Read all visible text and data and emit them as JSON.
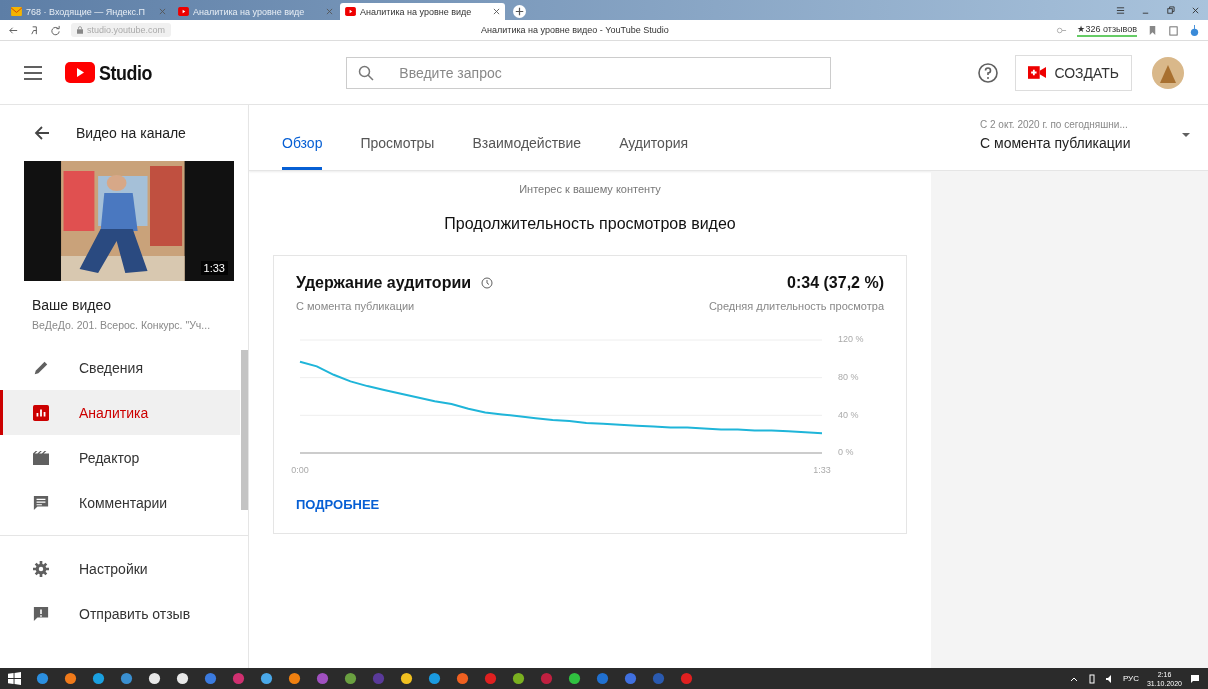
{
  "browser": {
    "tabs": [
      {
        "title": "768 · Входящие — Яндекс.П",
        "selected": false,
        "kind": "mail"
      },
      {
        "title": "Аналитика на уровне виде",
        "selected": false,
        "kind": "youtube"
      },
      {
        "title": "Аналитика на уровне виде",
        "selected": true,
        "kind": "youtube"
      }
    ],
    "url": "studio.youtube.com",
    "page_title": "Аналитика на уровне видео - YouTube Studio",
    "reviews": "★326 отзывов"
  },
  "header": {
    "logo": "Studio",
    "search_placeholder": "Введите запрос",
    "create_button": "СОЗДАТЬ"
  },
  "sidebar": {
    "back_label": "Видео на канале",
    "duration": "1:33",
    "video_heading": "Ваше видео",
    "video_title": "ВеДеДо. 201. Всерос. Конкурс. \"Уч...",
    "items": [
      {
        "label": "Сведения",
        "kind": "pencil",
        "selected": false
      },
      {
        "label": "Аналитика",
        "kind": "analytics",
        "selected": true
      },
      {
        "label": "Редактор",
        "kind": "film",
        "selected": false
      },
      {
        "label": "Комментарии",
        "kind": "comment",
        "selected": false
      }
    ],
    "footer_items": [
      {
        "label": "Настройки",
        "kind": "gear"
      },
      {
        "label": "Отправить отзыв",
        "kind": "feedback"
      }
    ]
  },
  "tabs": [
    {
      "label": "Обзор",
      "selected": true
    },
    {
      "label": "Просмотры",
      "selected": false
    },
    {
      "label": "Взаимодействие",
      "selected": false
    },
    {
      "label": "Аудитория",
      "selected": false
    }
  ],
  "date_range": {
    "range": "С 2 окт. 2020 г. по сегодняшни...",
    "value": "С момента публикации"
  },
  "section_label": "Интерес к вашему контенту",
  "section_title": "Продолжительность просмотров видео",
  "card": {
    "title": "Удержание аудитории",
    "subtitle": "С момента публикации",
    "metric": "0:34 (37,2 %)",
    "metric_label": "Средняя длительность просмотра",
    "link": "ПОДРОБНЕЕ",
    "chart_data": {
      "type": "line",
      "x": [
        0,
        3,
        6,
        9,
        12,
        15,
        18,
        21,
        24,
        27,
        30,
        33,
        36,
        39,
        42,
        45,
        48,
        51,
        54,
        57,
        60,
        63,
        66,
        69,
        72,
        75,
        78,
        81,
        84,
        87,
        90,
        93
      ],
      "series": [
        {
          "color": "#1fb5d9",
          "values": [
            97,
            92,
            83,
            76,
            71,
            67,
            63,
            59,
            55,
            52,
            47,
            43,
            41,
            39,
            37,
            35,
            34,
            32,
            31,
            30,
            29,
            28,
            27,
            27,
            26,
            25,
            25,
            24,
            24,
            23,
            22,
            21
          ]
        }
      ],
      "xlim": [
        0,
        93
      ],
      "ylim": [
        0,
        120
      ],
      "xticks": [
        {
          "value": 0,
          "label": "0:00"
        },
        {
          "value": 93,
          "label": "1:33"
        }
      ],
      "yticks": [
        {
          "value": 0,
          "label": "0 %"
        },
        {
          "value": 40,
          "label": "40 %"
        },
        {
          "value": 80,
          "label": "80 %"
        },
        {
          "value": 120,
          "label": "120 %"
        }
      ]
    }
  },
  "taskbar": {
    "language": "РУС",
    "time": "2:16",
    "date": "31.10.2020"
  }
}
